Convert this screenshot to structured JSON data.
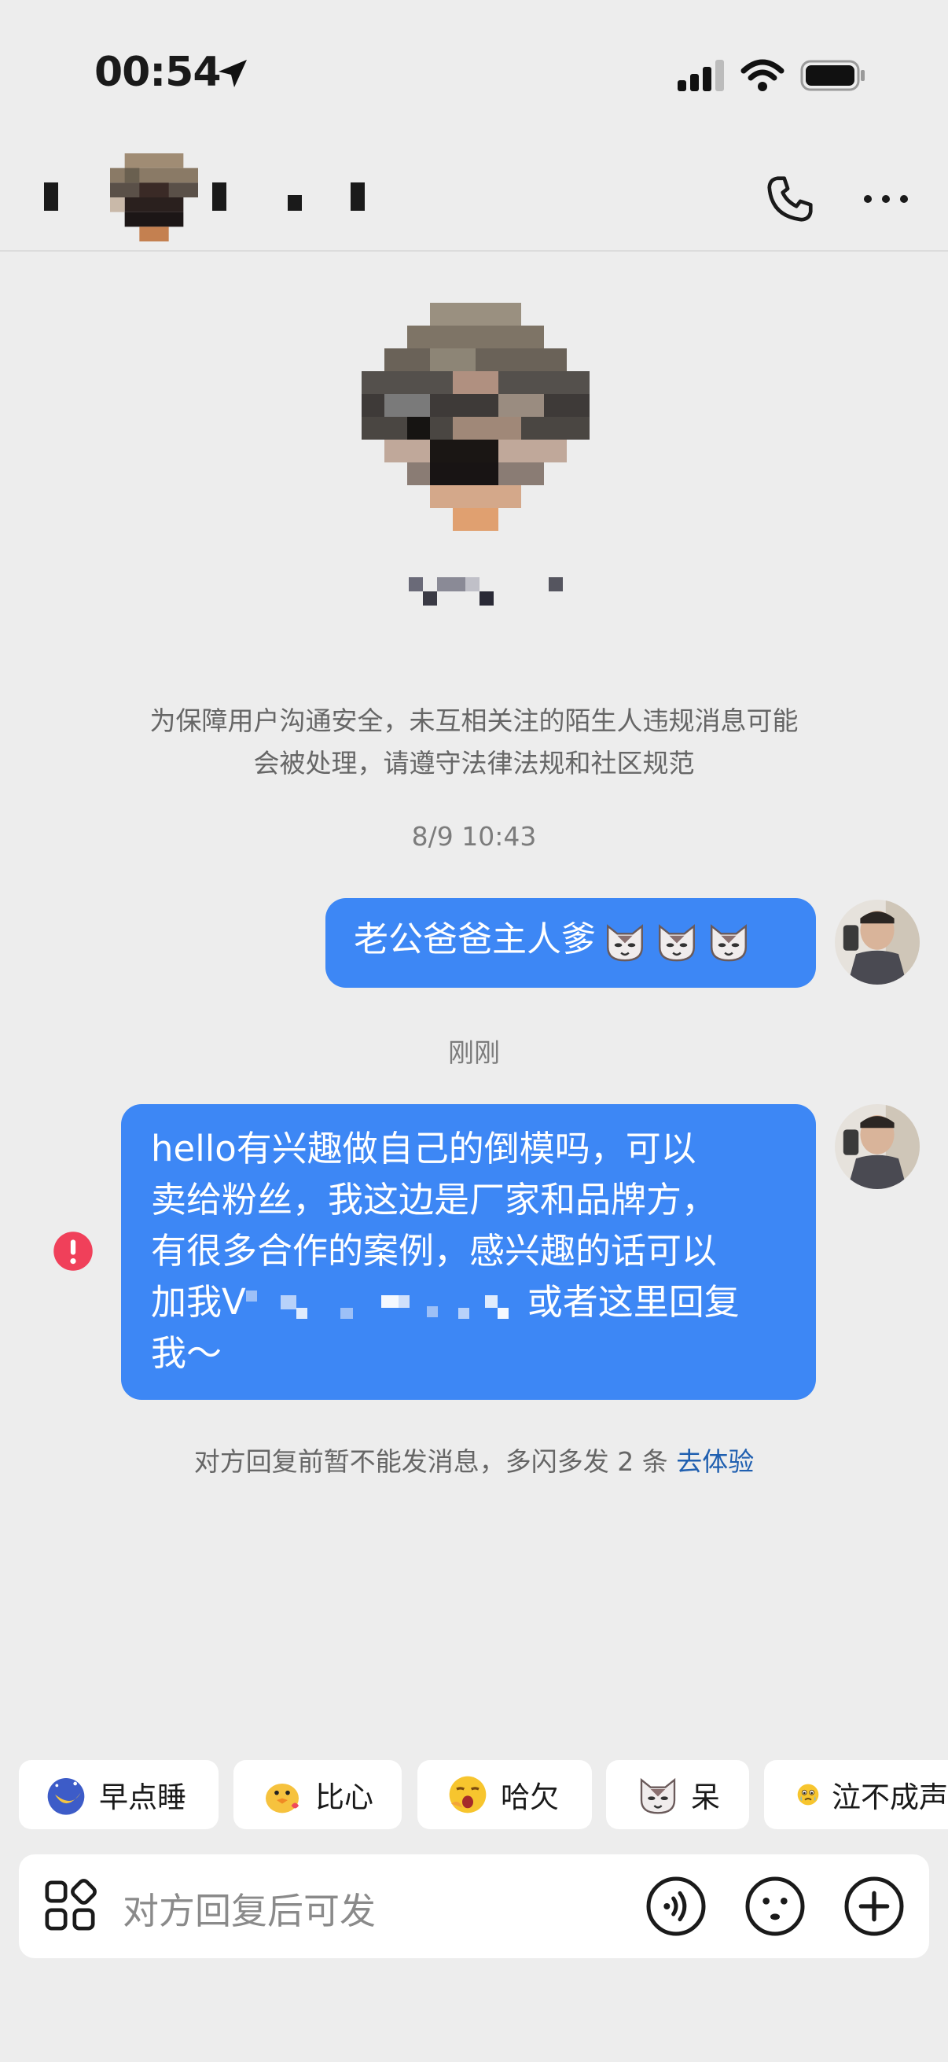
{
  "status_bar": {
    "time": "00:54"
  },
  "header": {
    "actions": [
      "call-icon",
      "more-icon"
    ]
  },
  "notice": {
    "line1": "为保障用户沟通安全，未互相关注的陌生人违规消息可能",
    "line2": "会被处理，请遵守法律法规和社区规范"
  },
  "messages": [
    {
      "timestamp": "8/9 10:43",
      "text": "老公爸爸主人爹",
      "emojis": [
        "cat-face",
        "cat-face",
        "cat-face"
      ],
      "outgoing": true
    },
    {
      "timestamp": "刚刚",
      "lines": [
        "hello有兴趣做自己的倒模吗，可以",
        "卖给粉丝，我这边是厂家和品牌方，",
        "有很多合作的案例，感兴趣的话可以"
      ],
      "line4_prefix": "加我V",
      "line4_suffix": "或者这里回复",
      "line5": "我～",
      "outgoing": true,
      "failed": true
    }
  ],
  "system_notice": {
    "text": "对方回复前暂不能发消息，多闪多发 2 条 ",
    "link": "去体验"
  },
  "quick_replies": [
    {
      "label": "早点睡",
      "emoji": "sleepy-moon"
    },
    {
      "label": "比心",
      "emoji": "heart-duck"
    },
    {
      "label": "哈欠",
      "emoji": "yawn-face"
    },
    {
      "label": "呆",
      "emoji": "cat-face"
    },
    {
      "label": "泣不成声",
      "emoji": "crying-face"
    }
  ],
  "input": {
    "placeholder": "对方回复后可发"
  },
  "colors": {
    "bubble": "#3d87f5",
    "background": "#ededed",
    "link": "#1f5fb0",
    "error": "#f0405a"
  }
}
